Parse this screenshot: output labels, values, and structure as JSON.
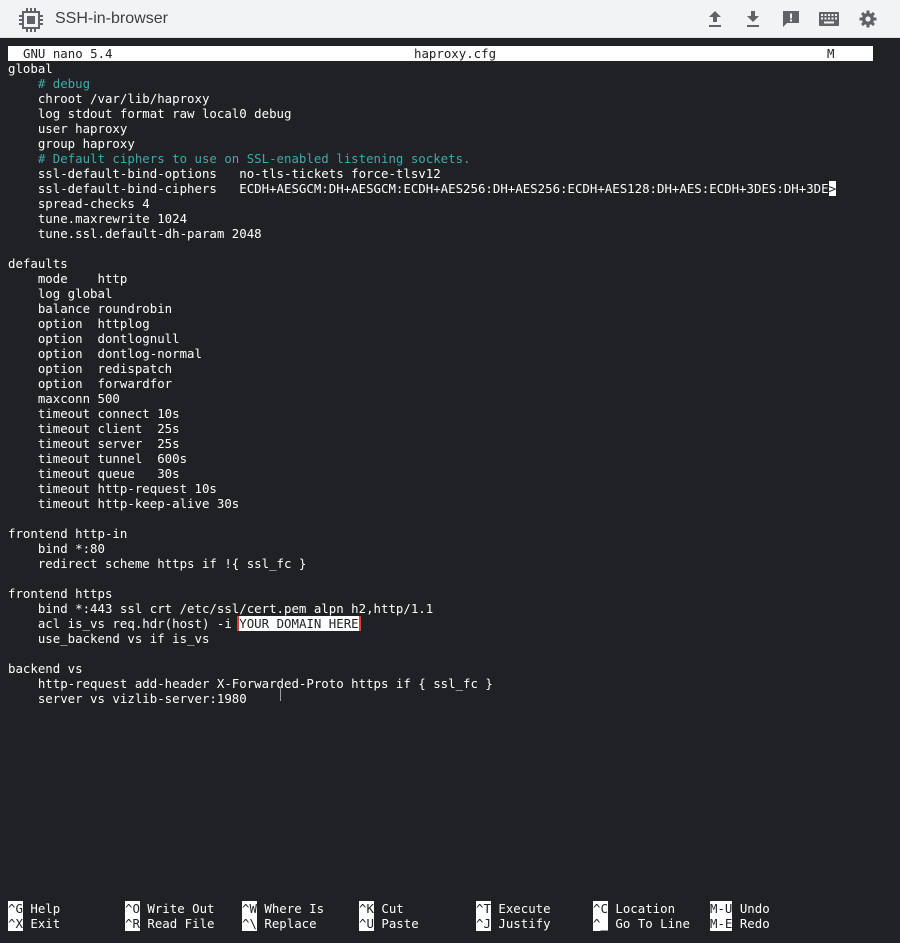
{
  "app": {
    "title": "SSH-in-browser"
  },
  "toolbar": {
    "icons": [
      "upload-icon",
      "download-icon",
      "feedback-icon",
      "keyboard-icon",
      "settings-icon"
    ]
  },
  "nano": {
    "version": "GNU nano 5.4",
    "filename": "haproxy.cfg",
    "modified": "M"
  },
  "editor": {
    "lines": [
      "global",
      "    # debug",
      "    chroot /var/lib/haproxy",
      "    log stdout format raw local0 debug",
      "    user haproxy",
      "    group haproxy",
      "    # Default ciphers to use on SSL-enabled listening sockets.",
      "    ssl-default-bind-options   no-tls-tickets force-tlsv12",
      "    ssl-default-bind-ciphers   ECDH+AESGCM:DH+AESGCM:ECDH+AES256:DH+AES256:ECDH+AES128:DH+AES:ECDH+3DES:DH+3DE",
      "    spread-checks 4",
      "    tune.maxrewrite 1024",
      "    tune.ssl.default-dh-param 2048",
      "",
      "defaults",
      "    mode    http",
      "    log global",
      "    balance roundrobin",
      "    option  httplog",
      "    option  dontlognull",
      "    option  dontlog-normal",
      "    option  redispatch",
      "    option  forwardfor",
      "    maxconn 500",
      "    timeout connect 10s",
      "    timeout client  25s",
      "    timeout server  25s",
      "    timeout tunnel  600s",
      "    timeout queue   30s",
      "    timeout http-request 10s",
      "    timeout http-keep-alive 30s",
      "",
      "frontend http-in",
      "    bind *:80",
      "    redirect scheme https if !{ ssl_fc }",
      "",
      "frontend https",
      "    bind *:443 ssl crt /etc/ssl/cert.pem alpn h2,http/1.1",
      "    acl is_vs req.hdr(host) -i ",
      "    use_backend vs if is_vs",
      "",
      "backend vs",
      "    http-request add-header X-Forwarded-Proto https if { ssl_fc }",
      "    server vs vizlib-server:1980"
    ],
    "overflow_marker": ">",
    "highlighted_text": "YOUR DOMAIN HERE"
  },
  "shortcuts": [
    {
      "key": "^G",
      "label": "Help"
    },
    {
      "key": "^O",
      "label": "Write Out"
    },
    {
      "key": "^W",
      "label": "Where Is"
    },
    {
      "key": "^K",
      "label": "Cut"
    },
    {
      "key": "^T",
      "label": "Execute"
    },
    {
      "key": "^C",
      "label": "Location"
    },
    {
      "key": "M-U",
      "label": "Undo"
    },
    {
      "key": "^X",
      "label": "Exit"
    },
    {
      "key": "^R",
      "label": "Read File"
    },
    {
      "key": "^\\",
      "label": "Replace"
    },
    {
      "key": "^U",
      "label": "Paste"
    },
    {
      "key": "^J",
      "label": "Justify"
    },
    {
      "key": "^_",
      "label": "Go To Line"
    },
    {
      "key": "M-E",
      "label": "Redo"
    }
  ],
  "colors": {
    "terminal_bg": "#202124",
    "terminal_fg": "#ffffff",
    "comment": "#3fa9a9",
    "highlight_border": "#e53935"
  }
}
